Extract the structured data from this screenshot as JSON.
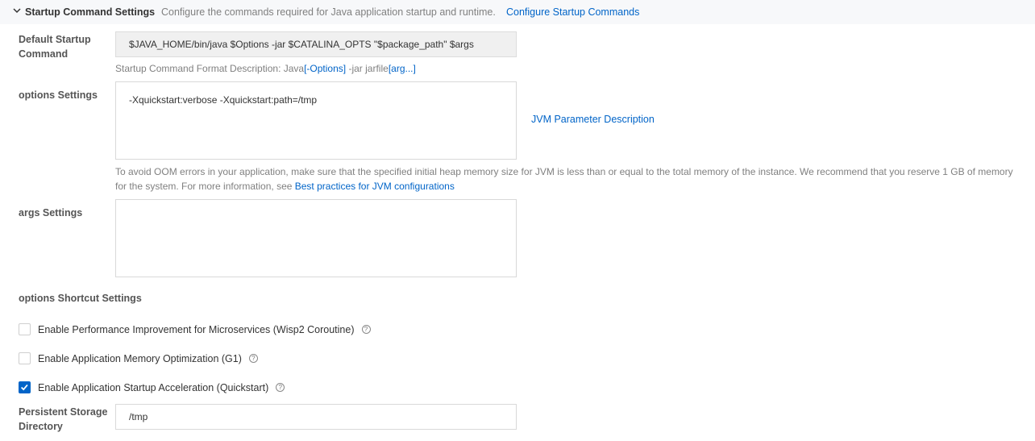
{
  "section": {
    "title": "Startup Command Settings",
    "description": "Configure the commands required for Java application startup and runtime.",
    "link": "Configure Startup Commands"
  },
  "default_command": {
    "label_line1": "Default Startup",
    "label_line2": "Command",
    "value": "$JAVA_HOME/bin/java $Options -jar $CATALINA_OPTS \"$package_path\" $args",
    "format_prefix": "Startup Command Format Description: Java",
    "format_options": "[-Options]",
    "format_middle": " -jar jarfile",
    "format_args": "[arg...]"
  },
  "options_settings": {
    "label": "options Settings",
    "value": "-Xquickstart:verbose -Xquickstart:path=/tmp",
    "jvm_link": "JVM Parameter Description",
    "note_line1": "To avoid OOM errors in your application, make sure that the specified initial heap memory size for JVM is less than or equal to the total memory of the instance. We recommend that you reserve 1 GB of memory",
    "note_line2": "for the system. For more information, see ",
    "note_link": "Best practices for JVM configurations"
  },
  "args_settings": {
    "label": "args Settings",
    "value": ""
  },
  "shortcut": {
    "label": "options Shortcut Settings",
    "items": [
      {
        "label": "Enable Performance Improvement for Microservices (Wisp2 Coroutine)",
        "checked": false
      },
      {
        "label": "Enable Application Memory Optimization (G1)",
        "checked": false
      },
      {
        "label": "Enable Application Startup Acceleration (Quickstart)",
        "checked": true
      }
    ]
  },
  "storage": {
    "label_line1": "Persistent Storage",
    "label_line2": "Directory",
    "value": "/tmp"
  },
  "colors": {
    "accent": "#0064c8",
    "header_bg": "#f7f8fa"
  },
  "icons": {
    "collapse": "chevron-down-icon",
    "help": "question-circle-icon",
    "check": "check-icon"
  }
}
